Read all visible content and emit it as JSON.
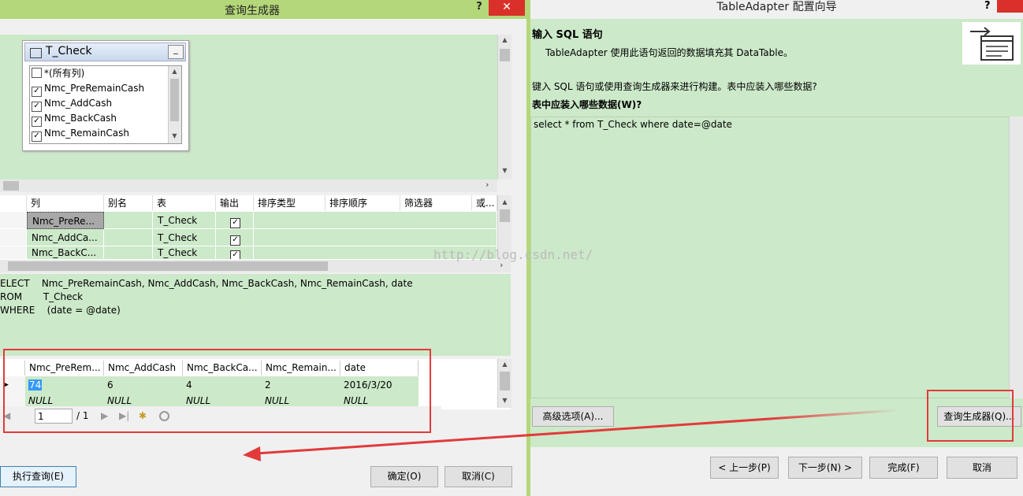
{
  "query_builder": {
    "title": "查询生成器",
    "help": "?",
    "close": "✕",
    "table_box": {
      "title": "T_Check",
      "minimize": "_",
      "columns": [
        {
          "label": "*(所有列)",
          "checked": false
        },
        {
          "label": "Nmc_PreRemainCash",
          "checked": true
        },
        {
          "label": "Nmc_AddCash",
          "checked": true
        },
        {
          "label": "Nmc_BackCash",
          "checked": true
        },
        {
          "label": "Nmc_RemainCash",
          "checked": true
        }
      ]
    },
    "grid": {
      "headers": [
        "列",
        "别名",
        "表",
        "输出",
        "排序类型",
        "排序顺序",
        "筛选器",
        "或..."
      ],
      "rows": [
        {
          "column": "Nmc_PreRe...",
          "alias": "",
          "table": "T_Check",
          "output": true
        },
        {
          "column": "Nmc_AddCa...",
          "alias": "",
          "table": "T_Check",
          "output": true
        },
        {
          "column": "Nmc_BackC...",
          "alias": "",
          "table": "T_Check",
          "output": true
        }
      ]
    },
    "sql": {
      "line1": "ELECT    Nmc_PreRemainCash, Nmc_AddCash, Nmc_BackCash, Nmc_RemainCash, date",
      "line2": "ROM       T_Check",
      "line3": "WHERE    (date = @date)"
    },
    "results": {
      "headers": [
        "Nmc_PreRem...",
        "Nmc_AddCash",
        "Nmc_BackCa...",
        "Nmc_Remain...",
        "date"
      ],
      "rows": [
        [
          "74",
          "6",
          "4",
          "2",
          "2016/3/20"
        ],
        [
          "NULL",
          "NULL",
          "NULL",
          "NULL",
          "NULL"
        ]
      ]
    },
    "nav": {
      "page": "1",
      "of": "/ 1"
    },
    "buttons": {
      "execute": "执行查询(E)",
      "ok": "确定(O)",
      "cancel": "取消(C)"
    }
  },
  "wizard": {
    "title": "TableAdapter 配置向导",
    "help": "?",
    "header_title": "输入 SQL 语句",
    "header_desc": "TableAdapter 使用此语句返回的数据填充其 DataTable。",
    "instruction": "键入 SQL 语句或使用查询生成器来进行构建。表中应装入哪些数据?",
    "question": "表中应装入哪些数据(W)?",
    "sql_text": "select * from T_Check where date=@date",
    "buttons": {
      "advanced": "高级选项(A)...",
      "query_builder": "查询生成器(Q)...",
      "prev": "< 上一步(P)",
      "next": "下一步(N) >",
      "finish": "完成(F)",
      "cancel": "取消"
    }
  },
  "watermark": "http://blog.csdn.net/",
  "colors": {
    "annotation_red": "#e23a3a",
    "title_green": "#b4d77a",
    "pane_green": "#cce9c9"
  }
}
